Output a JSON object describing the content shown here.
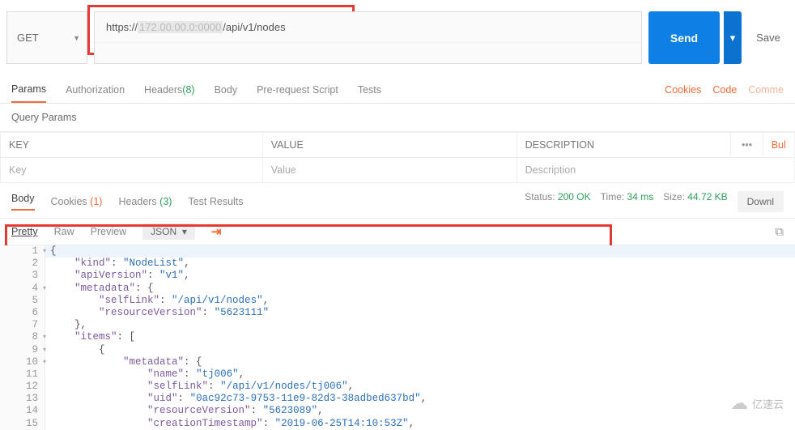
{
  "request": {
    "method": "GET",
    "url_prefix": "https://",
    "url_redacted": "172.00.00.0:0000",
    "url_suffix": "/api/v1/nodes",
    "send_label": "Send",
    "save_label": "Save"
  },
  "req_tabs": {
    "params": "Params",
    "auth": "Authorization",
    "headers": "Headers",
    "headers_count": "(8)",
    "body": "Body",
    "prerequest": "Pre-request Script",
    "tests": "Tests",
    "cookies": "Cookies",
    "code": "Code",
    "comments": "Comme"
  },
  "query_params": {
    "title": "Query Params",
    "key_hdr": "KEY",
    "value_hdr": "VALUE",
    "desc_hdr": "DESCRIPTION",
    "more": "•••",
    "bulk": "Bul",
    "key_ph": "Key",
    "value_ph": "Value",
    "desc_ph": "Description"
  },
  "response": {
    "body": "Body",
    "cookies": "Cookies",
    "cookies_count": "(1)",
    "headers": "Headers",
    "headers_count": "(3)",
    "test_results": "Test Results",
    "status_label": "Status:",
    "status_value": "200 OK",
    "time_label": "Time:",
    "time_value": "34 ms",
    "size_label": "Size:",
    "size_value": "44.72 KB",
    "download": "Downl"
  },
  "viewbar": {
    "pretty": "Pretty",
    "raw": "Raw",
    "preview": "Preview",
    "json": "JSON",
    "json_caret": "▾"
  },
  "code_lines": [
    {
      "n": "1",
      "fold": true,
      "indent": 0,
      "raw": "{",
      "hl": true
    },
    {
      "n": "2",
      "indent": 1,
      "k": "\"kind\"",
      "v": "\"NodeList\"",
      "comma": ","
    },
    {
      "n": "3",
      "indent": 1,
      "k": "\"apiVersion\"",
      "v": "\"v1\"",
      "comma": ","
    },
    {
      "n": "4",
      "fold": true,
      "indent": 1,
      "k": "\"metadata\"",
      "raw": ": {"
    },
    {
      "n": "5",
      "indent": 2,
      "k": "\"selfLink\"",
      "v": "\"/api/v1/nodes\"",
      "comma": ","
    },
    {
      "n": "6",
      "indent": 2,
      "k": "\"resourceVersion\"",
      "v": "\"5623111\""
    },
    {
      "n": "7",
      "indent": 1,
      "raw": "},"
    },
    {
      "n": "8",
      "fold": true,
      "indent": 1,
      "k": "\"items\"",
      "raw": ": ["
    },
    {
      "n": "9",
      "fold": true,
      "indent": 2,
      "raw": "{"
    },
    {
      "n": "10",
      "fold": true,
      "indent": 3,
      "k": "\"metadata\"",
      "raw": ": {"
    },
    {
      "n": "11",
      "indent": 4,
      "k": "\"name\"",
      "v": "\"tj006\"",
      "comma": ","
    },
    {
      "n": "12",
      "indent": 4,
      "k": "\"selfLink\"",
      "v": "\"/api/v1/nodes/tj006\"",
      "comma": ","
    },
    {
      "n": "13",
      "indent": 4,
      "k": "\"uid\"",
      "v": "\"0ac92c73-9753-11e9-82d3-38adbed637bd\"",
      "comma": ","
    },
    {
      "n": "14",
      "indent": 4,
      "k": "\"resourceVersion\"",
      "v": "\"5623089\"",
      "comma": ","
    },
    {
      "n": "15",
      "indent": 4,
      "k": "\"creationTimestamp\"",
      "v": "\"2019-06-25T14:10:53Z\"",
      "comma": ","
    }
  ],
  "footer": {
    "brand": "亿速云",
    "watermark": ""
  }
}
